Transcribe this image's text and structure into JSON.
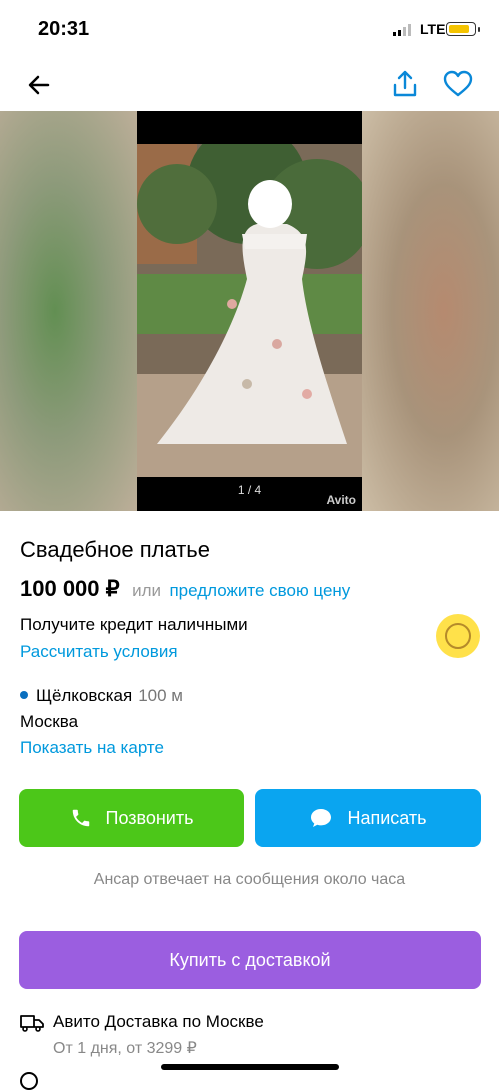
{
  "status": {
    "time": "20:31",
    "network": "LTE"
  },
  "nav": {
    "back_icon": "arrow-left-icon",
    "share_icon": "share-icon",
    "favorite_icon": "heart-icon"
  },
  "gallery": {
    "counter": "1 / 4",
    "watermark": "Avito"
  },
  "listing": {
    "title": "Свадебное платье",
    "price": "100 000 ₽",
    "or_text": "или",
    "offer_link": "предложите свою цену",
    "credit_text": "Получите кредит наличными",
    "credit_link": "Рассчитать условия"
  },
  "location": {
    "metro": "Щёлковская",
    "distance": "100 м",
    "city": "Москва",
    "map_link": "Показать на карте"
  },
  "actions": {
    "call": "Позвонить",
    "write": "Написать",
    "reply_note": "Ансар отвечает на сообщения около часа",
    "buy": "Купить с доставкой"
  },
  "delivery": {
    "title": "Авито Доставка по Москве",
    "subtitle": "От 1 дня, от 3299 ₽"
  },
  "colors": {
    "call": "#4cc719",
    "write": "#0aa5f0",
    "buy": "#9b5ee0",
    "link": "#0099dd"
  }
}
